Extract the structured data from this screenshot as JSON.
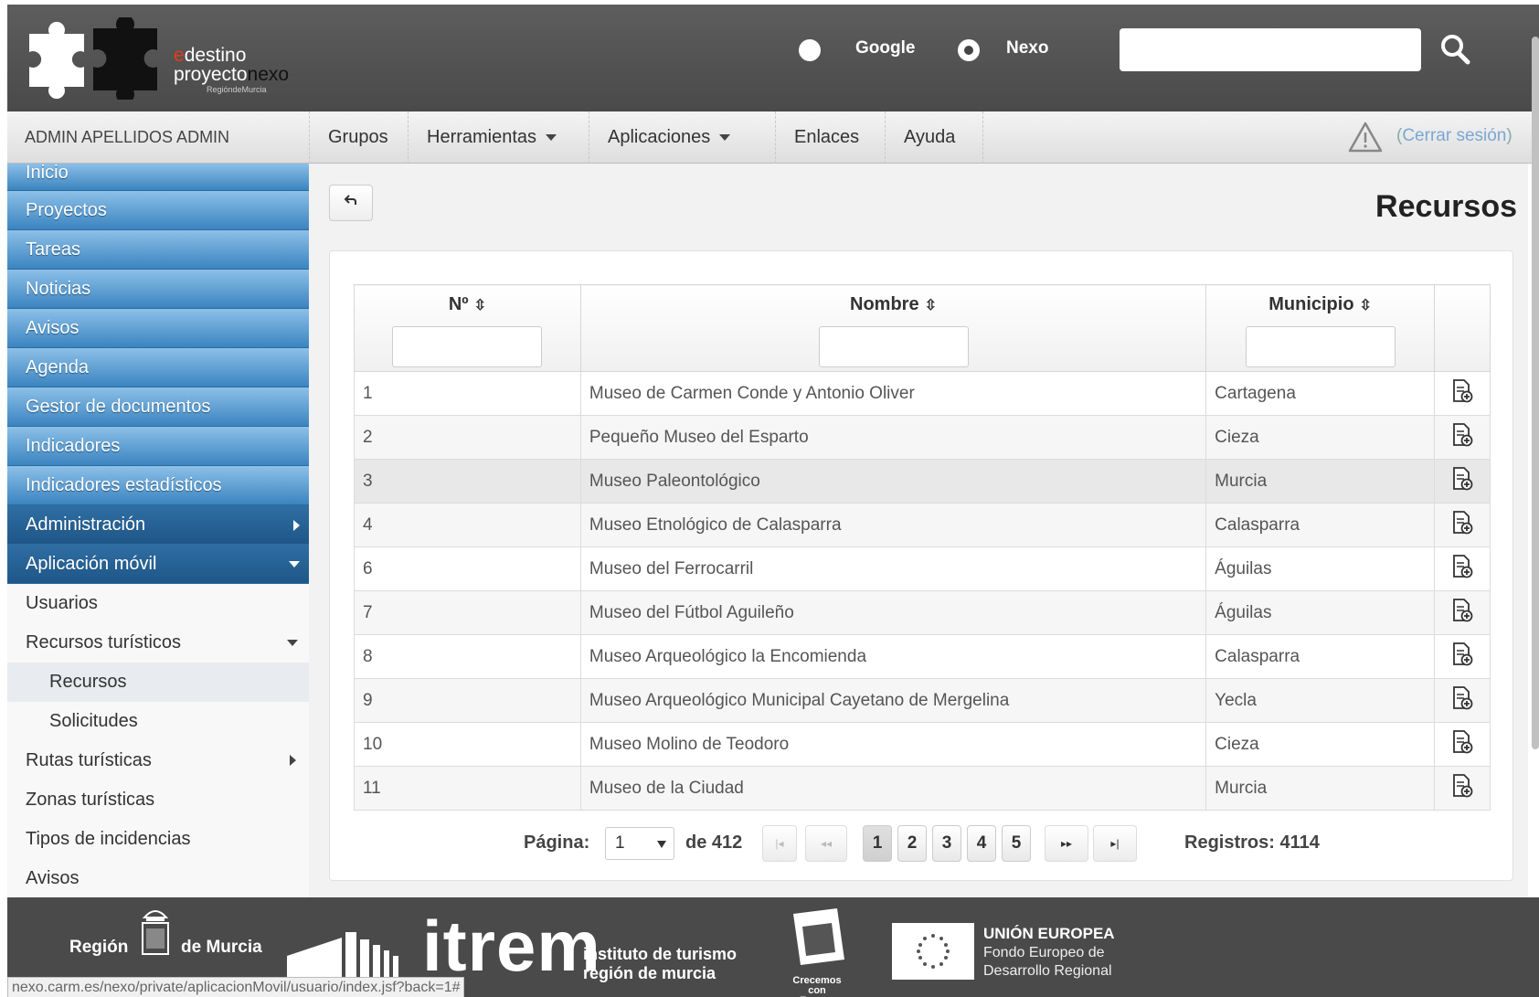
{
  "header": {
    "logo": {
      "line1_accent": "e",
      "line1_rest": "destino",
      "line2_main": "proyecto",
      "line2_accent": "nexo",
      "line3": "RegióndeMurcia"
    },
    "search_engines": [
      {
        "label": "Google",
        "selected": false
      },
      {
        "label": "Nexo",
        "selected": true
      }
    ],
    "search": {
      "value": "",
      "placeholder": ""
    },
    "search_icon": "magnifier-icon"
  },
  "menubar": {
    "user": "ADMIN APELLIDOS ADMIN",
    "items": [
      "Grupos",
      "Herramientas",
      "Aplicaciones",
      "Enlaces",
      "Ayuda"
    ],
    "logout_prefix": "(",
    "logout_label": "Cerrar sesión",
    "logout_suffix": ")",
    "warning_icon": "warning-triangle-icon"
  },
  "sidebar": {
    "blue_items": [
      "Inicio",
      "Proyectos",
      "Tareas",
      "Noticias",
      "Avisos",
      "Agenda",
      "Gestor de documentos",
      "Indicadores",
      "Indicadores estadísticos",
      "Administración",
      "Aplicación móvil"
    ],
    "sub_items": [
      "Usuarios",
      "Recursos turísticos",
      "Recursos",
      "Solicitudes",
      "Rutas turísticas",
      "Zonas turísticas",
      "Tipos de incidencias",
      "Avisos"
    ]
  },
  "main": {
    "back_icon": "back-arrow-icon",
    "title": "Recursos",
    "table": {
      "columns": [
        "Nº",
        "Nombre",
        "Municipio"
      ],
      "sort_icon": "⇳",
      "rows": [
        [
          "1",
          "Museo de Carmen Conde y Antonio Oliver",
          "Cartagena"
        ],
        [
          "2",
          "Pequeño Museo del Esparto",
          "Cieza"
        ],
        [
          "3",
          "Museo Paleontológico",
          "Murcia"
        ],
        [
          "4",
          "Museo Etnológico de Calasparra",
          "Calasparra"
        ],
        [
          "6",
          "Museo del Ferrocarril",
          "Águilas"
        ],
        [
          "7",
          "Museo del Fútbol Aguileño",
          "Águilas"
        ],
        [
          "8",
          "Museo Arqueológico la Encomienda",
          "Calasparra"
        ],
        [
          "9",
          "Museo Arqueológico Municipal Cayetano de Mergelina",
          "Yecla"
        ],
        [
          "10",
          "Museo Molino de Teodoro",
          "Cieza"
        ],
        [
          "11",
          "Museo de la Ciudad",
          "Murcia"
        ]
      ],
      "row_action_icon": "document-add-icon"
    },
    "pager": {
      "label": "Página:",
      "current": "1",
      "of": "de 412",
      "first": "|◂",
      "prev": "◂◂",
      "next": "▸▸",
      "last": "▸|",
      "pages": [
        "1",
        "2",
        "3",
        "4",
        "5"
      ],
      "total": "Registros: 4114"
    }
  },
  "footer": {
    "region_left": "Región",
    "region_right": "de Murcia",
    "itrem": "itrem",
    "itrem_line1": "instituto de turismo",
    "itrem_line2": "región de murcia",
    "crecemos": "Crecemos con Europa",
    "eu_line1": "UNIÓN EUROPEA",
    "eu_line2": "Fondo Europeo de",
    "eu_line3": "Desarrollo Regional"
  },
  "status_url": "nexo.carm.es/nexo/private/aplicacionMovil/usuario/index.jsf?back=1#"
}
